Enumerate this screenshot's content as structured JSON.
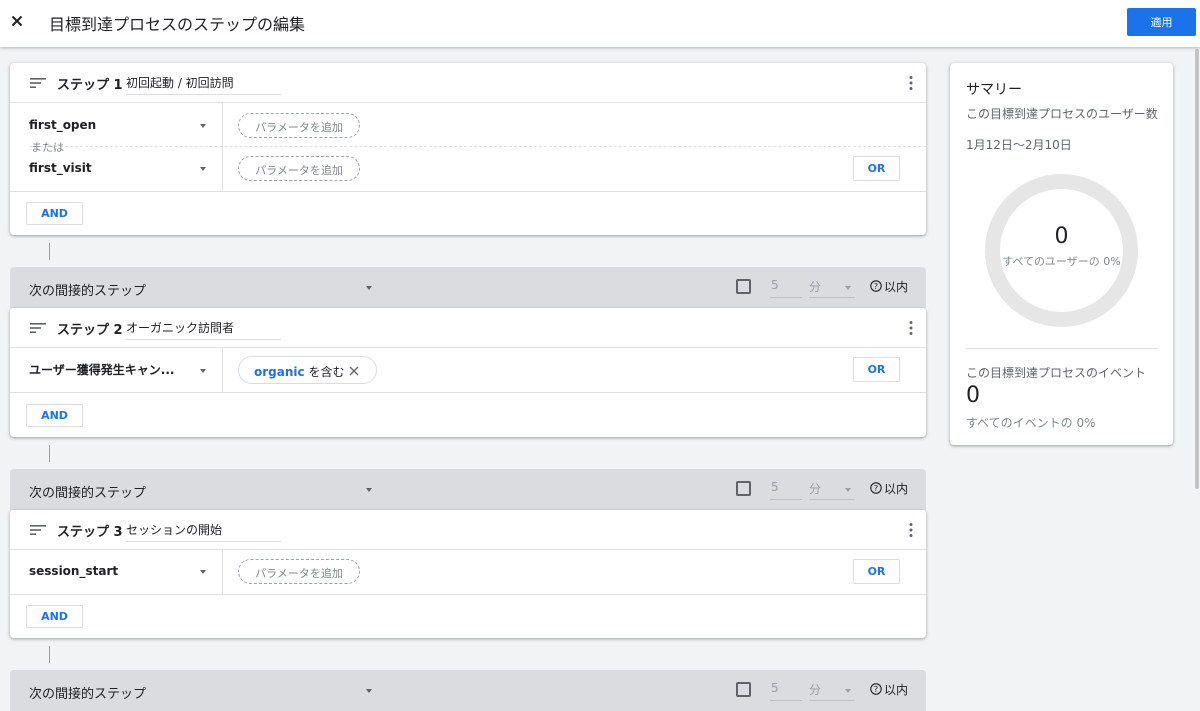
{
  "header": {
    "title": "目標到達プロセスのステップの編集",
    "apply_label": "適用",
    "close_icon": "close-icon"
  },
  "steps": [
    {
      "label": "ステップ 1",
      "name": "初回起動 / 初回訪問",
      "conditions": [
        {
          "event": "first_open",
          "param_label": "パラメータを追加"
        },
        {
          "event": "first_visit",
          "param_label": "パラメータを追加"
        }
      ],
      "or_text": "または",
      "or_label": "OR",
      "and_label": "AND"
    },
    {
      "label": "ステップ 2",
      "name": "オーガニック訪問者",
      "conditions": [
        {
          "event": "ユーザー獲得発生キャン...",
          "filter_value": "organic",
          "filter_op": "を含む"
        }
      ],
      "or_label": "OR",
      "and_label": "AND"
    },
    {
      "label": "ステップ 3",
      "name": "セッションの開始",
      "conditions": [
        {
          "event": "session_start",
          "param_label": "パラメータを追加"
        }
      ],
      "or_label": "OR",
      "and_label": "AND"
    }
  ],
  "sequence": [
    {
      "label": "次の間接的ステップ",
      "within_value": "5",
      "within_unit": "分",
      "within_label": "以内",
      "checked": false
    },
    {
      "label": "次の間接的ステップ",
      "within_value": "5",
      "within_unit": "分",
      "within_label": "以内",
      "checked": false
    },
    {
      "label": "次の間接的ステップ",
      "within_value": "5",
      "within_unit": "分",
      "within_label": "以内",
      "checked": false
    }
  ],
  "summary": {
    "title": "サマリー",
    "users_label": "この目標到達プロセスのユーザー数",
    "date_range": "1月12日～2月10日",
    "users_value": "0",
    "users_pct": "すべてのユーザーの 0%",
    "users_fraction": 0,
    "events_label": "この目標到達プロセスのイベント",
    "events_value": "0",
    "events_pct": "すべてのイベントの 0%"
  },
  "colors": {
    "accent": "#1a73e8",
    "bar": "#dadce0",
    "background": "#f1f3f4",
    "donut_ring": "#e6e6e6"
  }
}
